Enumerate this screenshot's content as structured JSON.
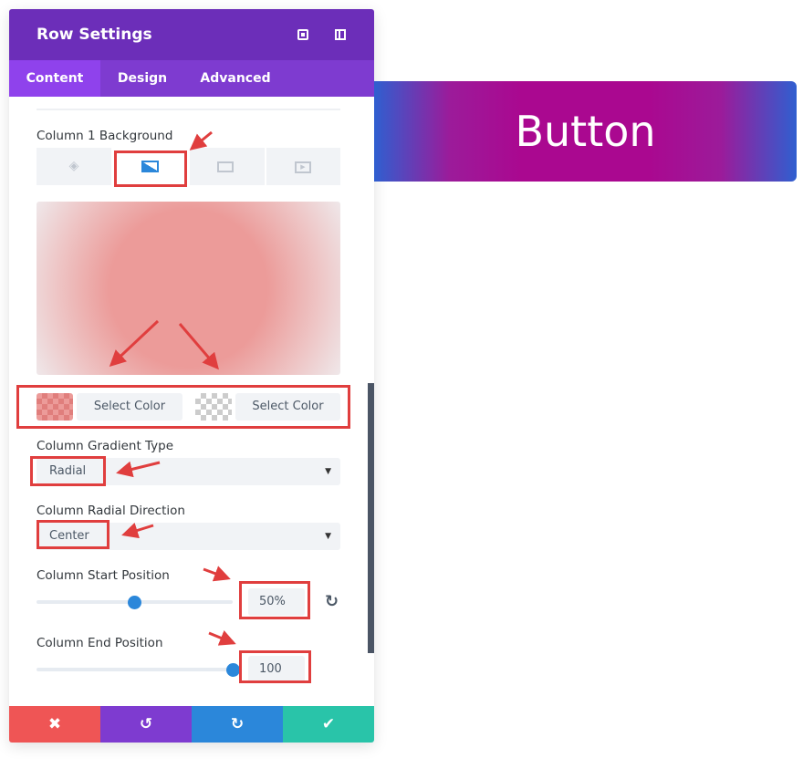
{
  "panel": {
    "title": "Row Settings",
    "header_icons": [
      "fullscreen-icon",
      "split-view-icon"
    ],
    "tabs": [
      {
        "label": "Content",
        "active": true
      },
      {
        "label": "Design"
      },
      {
        "label": "Advanced"
      }
    ],
    "background": {
      "label": "Column 1 Background",
      "tabs": [
        "color-icon",
        "gradient-icon",
        "image-icon",
        "video-icon"
      ],
      "active_tab": "gradient"
    },
    "gradient_colors": [
      {
        "label": "Select Color",
        "color": "#ec9b99"
      },
      {
        "label": "Select Color",
        "color": "transparent"
      }
    ],
    "gradient_type": {
      "label": "Column Gradient Type",
      "value": "Radial"
    },
    "radial_direction": {
      "label": "Column Radial Direction",
      "value": "Center"
    },
    "start_position": {
      "label": "Column Start Position",
      "value": "50%",
      "percent": 50
    },
    "end_position": {
      "label": "Column End Position",
      "value": "100",
      "percent": 100
    },
    "footer": [
      "close-icon",
      "undo-icon",
      "redo-icon",
      "check-icon"
    ],
    "colors": {
      "header": "#6c2eb9",
      "tabs": "#7e3bd0",
      "cancel": "#ef5555",
      "undo": "#7e3bd0",
      "redo": "#2b87da",
      "save": "#29c4a9",
      "annotation": "#e03e3e"
    }
  },
  "preview_button": {
    "label": "Button"
  }
}
